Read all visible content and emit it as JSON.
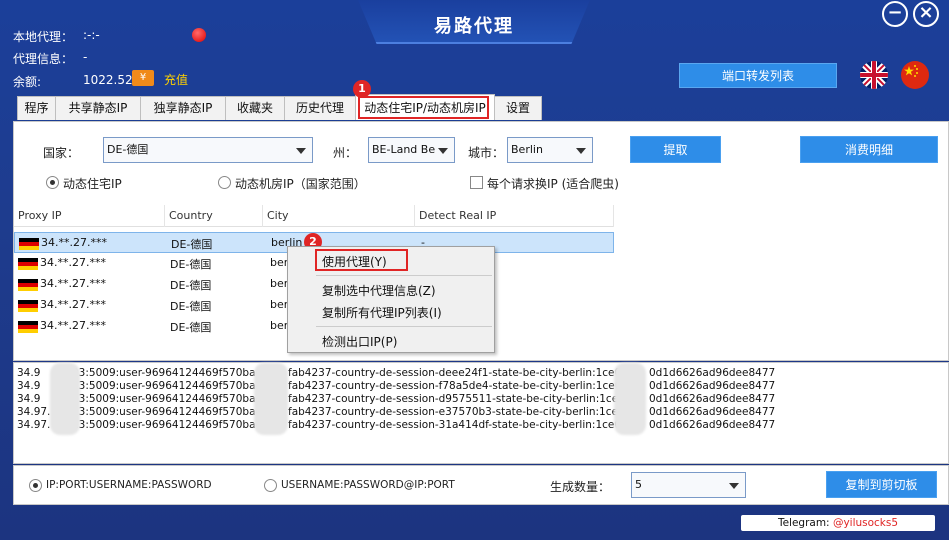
{
  "app": {
    "title": "易路代理",
    "minimize_icon": "minus-icon",
    "close_icon": "close-icon"
  },
  "info": {
    "local_proxy_label": "本地代理：",
    "local_proxy_value": ":-:-",
    "proxy_info_label": "代理信息：",
    "proxy_info_value": "-",
    "balance_label": "余额:",
    "balance_value": "1022.52",
    "recharge_label": "充值"
  },
  "header": {
    "port_forward_button": "端口转发列表"
  },
  "tabs": [
    {
      "label": "程序"
    },
    {
      "label": "共享静态IP"
    },
    {
      "label": "独享静态IP"
    },
    {
      "label": "收藏夹"
    },
    {
      "label": "历史代理"
    },
    {
      "label": "动态住宅IP/动态机房IP"
    },
    {
      "label": "设置"
    }
  ],
  "badges": {
    "one": "1",
    "two": "2"
  },
  "filters": {
    "country_label": "国家：",
    "country_value": "DE-德国",
    "state_label": "州：",
    "state_value": "BE-Land Be",
    "city_label": "城市：",
    "city_value": "Berlin",
    "fetch_button": "提取",
    "consumption_button": "消费明细",
    "radio_residential": "动态住宅IP",
    "radio_datacenter": "动态机房IP（国家范围）",
    "checkbox_rotate": "每个请求换IP (适合爬虫)"
  },
  "table": {
    "columns": [
      "Proxy IP",
      "Country",
      "City",
      "Detect Real IP"
    ],
    "rows": [
      {
        "ip": "34.**.27.***",
        "country": "DE-德国",
        "city": "berlin",
        "real": "-"
      },
      {
        "ip": "34.**.27.***",
        "country": "DE-德国",
        "city": "berl",
        "real": ""
      },
      {
        "ip": "34.**.27.***",
        "country": "DE-德国",
        "city": "berl",
        "real": ""
      },
      {
        "ip": "34.**.27.***",
        "country": "DE-德国",
        "city": "berl",
        "real": ""
      },
      {
        "ip": "34.**.27.***",
        "country": "DE-德国",
        "city": "berl",
        "real": ""
      }
    ]
  },
  "context_menu": {
    "use_proxy": "使用代理(Y)",
    "copy_selected": "复制选中代理信息(Z)",
    "copy_all": "复制所有代理IP列表(I)",
    "detect_exit": "检测出口IP(P)"
  },
  "output_lines": [
    {
      "a": "34.9",
      "b": "23:5009:user-96964124469f570bac6",
      "c": "fab4237-country-de-session-deee24f1-state-be-city-berlin:1ce0062",
      "d": "0d1d6626ad96dee8477"
    },
    {
      "a": "34.9",
      "b": "23:5009:user-96964124469f570bac6",
      "c": "fab4237-country-de-session-f78a5de4-state-be-city-berlin:1ce0062",
      "d": "0d1d6626ad96dee8477"
    },
    {
      "a": "34.9",
      "b": "23:5009:user-96964124469f570bac6",
      "c": "fab4237-country-de-session-d9575511-state-be-city-berlin:1ce0062",
      "d": "0d1d6626ad96dee8477"
    },
    {
      "a": "34.97.",
      "b": "23:5009:user-96964124469f570bac6",
      "c": "fab4237-country-de-session-e37570b3-state-be-city-berlin:1ce0062",
      "d": "0d1d6626ad96dee8477"
    },
    {
      "a": "34.97.",
      "b": "23:5009:user-96964124469f570bac62",
      "c": "fab4237-country-de-session-31a414df-state-be-city-berlin:1ce0062",
      "d": "0d1d6626ad96dee8477"
    }
  ],
  "bottom": {
    "format1": "IP:PORT:USERNAME:PASSWORD",
    "format2": "USERNAME:PASSWORD@IP:PORT",
    "count_label": "生成数量：",
    "count_value": "5",
    "copy_button": "复制到剪切板"
  },
  "telegram": {
    "prefix": "Telegram: ",
    "handle": "@yilusocks5"
  }
}
